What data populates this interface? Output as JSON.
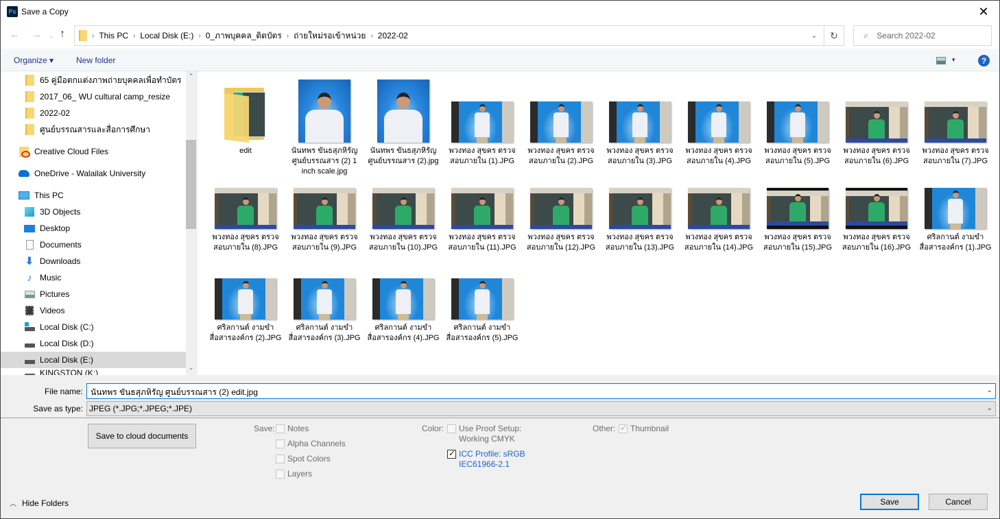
{
  "window": {
    "title": "Save a Copy",
    "app_icon": "Ps",
    "close_glyph": "✕"
  },
  "nav": {
    "back_glyph": "←",
    "forward_glyph": "→",
    "recent_glyph": "⌄",
    "up_glyph": "↑",
    "breadcrumbs": [
      "This PC",
      "Local Disk (E:)",
      "0_ภาพบุคคล_ติดบัตร",
      "ถ่ายใหม่รอเข้าหน่วย",
      "2022-02"
    ],
    "separator": "›",
    "dropdown_glyph": "⌄",
    "refresh_glyph": "↻",
    "search_placeholder": "Search 2022-02",
    "search_glyph": "⌕"
  },
  "toolbar": {
    "organize": "Organize ▾",
    "new_folder": "New folder",
    "view_dropdown": "▾",
    "help": "?"
  },
  "sidebar": {
    "items": [
      {
        "label": "65 คู่มือตกแต่งภาพถ่ายบุคคลเพื่อทำบัตร",
        "icon": "folder"
      },
      {
        "label": "2017_06_ WU cultural camp_resize",
        "icon": "folder"
      },
      {
        "label": "2022-02",
        "icon": "folder"
      },
      {
        "label": "ศูนย์บรรณสารและสื่อการศึกษา",
        "icon": "folder"
      },
      {
        "label": "Creative Cloud Files",
        "icon": "creative-cloud"
      },
      {
        "label": "OneDrive - Walailak University",
        "icon": "onedrive"
      },
      {
        "label": "This PC",
        "icon": "pc"
      },
      {
        "label": "3D Objects",
        "icon": "3d-objects"
      },
      {
        "label": "Desktop",
        "icon": "desktop"
      },
      {
        "label": "Documents",
        "icon": "documents"
      },
      {
        "label": "Downloads",
        "icon": "downloads"
      },
      {
        "label": "Music",
        "icon": "music"
      },
      {
        "label": "Pictures",
        "icon": "pictures"
      },
      {
        "label": "Videos",
        "icon": "videos"
      },
      {
        "label": "Local Disk (C:)",
        "icon": "drive-c"
      },
      {
        "label": "Local Disk (D:)",
        "icon": "drive"
      },
      {
        "label": "Local Disk (E:)",
        "icon": "drive",
        "selected": true
      },
      {
        "label": "KINGSTON (K:)",
        "icon": "usb"
      }
    ],
    "scroll_up": "⌃",
    "scroll_down": "⌄"
  },
  "files": [
    {
      "name": "edit",
      "kind": "folder"
    },
    {
      "name": "นันทพร ขันธสุภหิรัญ ศูนย์บรรณสาร (2) 1 inch scale.jpg",
      "kind": "portrait"
    },
    {
      "name": "นันทพร ขันธสุภหิรัญ ศูนย์บรรณสาร (2).jpg",
      "kind": "portrait"
    },
    {
      "name": "พวงทอง สุขคร ตรวจสอบภายใน (1).JPG",
      "kind": "studio"
    },
    {
      "name": "พวงทอง สุขคร ตรวจสอบภายใน (2).JPG",
      "kind": "studio"
    },
    {
      "name": "พวงทอง สุขคร ตรวจสอบภายใน (3).JPG",
      "kind": "studio"
    },
    {
      "name": "พวงทอง สุขคร ตรวจสอบภายใน (4).JPG",
      "kind": "studio"
    },
    {
      "name": "พวงทอง สุขคร ตรวจสอบภายใน (5).JPG",
      "kind": "studio"
    },
    {
      "name": "พวงทอง สุขคร ตรวจสอบภายใน (6).JPG",
      "kind": "office"
    },
    {
      "name": "พวงทอง สุขคร ตรวจสอบภายใน (7).JPG",
      "kind": "office"
    },
    {
      "name": "พวงทอง สุขคร ตรวจสอบภายใน (8).JPG",
      "kind": "office"
    },
    {
      "name": "พวงทอง สุขคร ตรวจสอบภายใน (9).JPG",
      "kind": "office"
    },
    {
      "name": "พวงทอง สุขคร ตรวจสอบภายใน (10).JPG",
      "kind": "office"
    },
    {
      "name": "พวงทอง สุขคร ตรวจสอบภายใน (11).JPG",
      "kind": "office"
    },
    {
      "name": "พวงทอง สุขคร ตรวจสอบภายใน (12).JPG",
      "kind": "office"
    },
    {
      "name": "พวงทอง สุขคร ตรวจสอบภายใน (13).JPG",
      "kind": "office"
    },
    {
      "name": "พวงทอง สุขคร ตรวจสอบภายใน (14).JPG",
      "kind": "office"
    },
    {
      "name": "พวงทอง สุขคร ตรวจสอบภายใน (15).JPG",
      "kind": "office-dark"
    },
    {
      "name": "พวงทอง สุขคร ตรวจสอบภายใน (16).JPG",
      "kind": "office-dark"
    },
    {
      "name": "ศริลกานต์ งามขำ สื่อสารองค์กร (1).JPG",
      "kind": "studio"
    },
    {
      "name": "ศริลกานต์ งามขำ สื่อสารองค์กร (2).JPG",
      "kind": "studio"
    },
    {
      "name": "ศริลกานต์ งามขำ สื่อสารองค์กร (3).JPG",
      "kind": "studio"
    },
    {
      "name": "ศริลกานต์ งามขำ สื่อสารองค์กร (4).JPG",
      "kind": "studio"
    },
    {
      "name": "ศริลกานต์ งามขำ สื่อสารองค์กร (5).JPG",
      "kind": "studio"
    }
  ],
  "form": {
    "file_name_label": "File name:",
    "file_name_value": "นันทพร ขันธสุภหิรัญ ศูนย์บรรณสาร (2) edit.jpg",
    "save_type_label": "Save as type:",
    "save_type_value": "JPEG (*.JPG;*.JPEG;*.JPE)",
    "dropdown_glyph": "⌄"
  },
  "options": {
    "cloud_button": "Save to cloud documents",
    "save_label": "Save:",
    "save_options": [
      {
        "label": "Notes",
        "checked": false
      },
      {
        "label": "Alpha Channels",
        "checked": false
      },
      {
        "label": "Spot Colors",
        "checked": false
      },
      {
        "label": "Layers",
        "checked": false
      }
    ],
    "color_label": "Color:",
    "proof_setup_line1": "Use Proof Setup:",
    "proof_setup_line2": "Working CMYK",
    "proof_setup_checked": false,
    "icc_line1": "ICC Profile:  sRGB",
    "icc_line2": "IEC61966-2.1",
    "icc_checked": true,
    "other_label": "Other:",
    "thumbnail_label": "Thumbnail",
    "thumbnail_checked": true
  },
  "footer": {
    "hide_folders": "Hide Folders",
    "hide_chevron": "︿",
    "save": "Save",
    "cancel": "Cancel",
    "grip": "⋰"
  },
  "colors": {
    "accent": "#0078d7",
    "link": "#1a65c8",
    "selected_row": "#d9d9d9"
  }
}
